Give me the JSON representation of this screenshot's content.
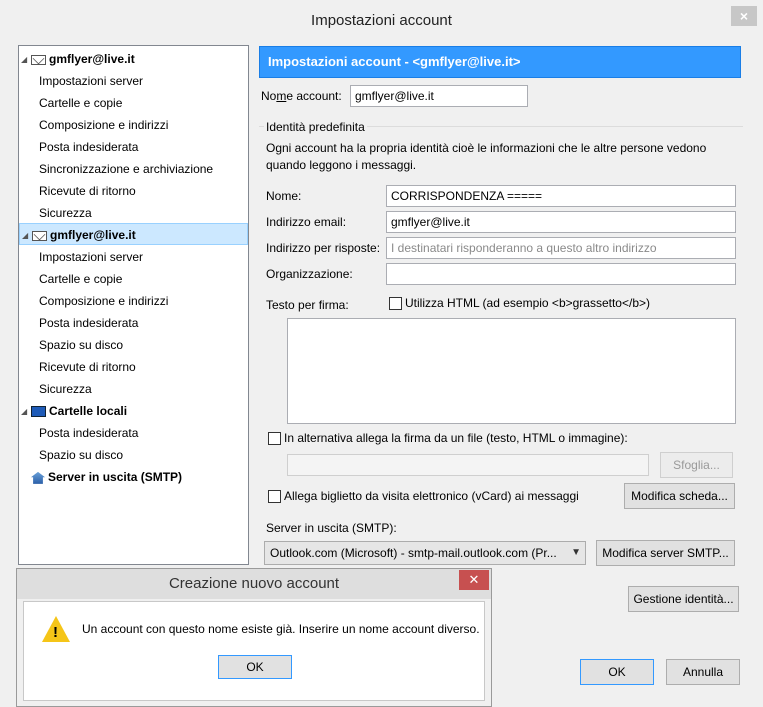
{
  "window": {
    "title": "Impostazioni account",
    "close_label": "×"
  },
  "tree": {
    "accounts": [
      {
        "name": "gmflyer@live.it",
        "items": [
          "Impostazioni server",
          "Cartelle e copie",
          "Composizione e indirizzi",
          "Posta indesiderata",
          "Sincronizzazione e archiviazione",
          "Ricevute di ritorno",
          "Sicurezza"
        ]
      },
      {
        "name": "gmflyer@live.it",
        "items": [
          "Impostazioni server",
          "Cartelle e copie",
          "Composizione e indirizzi",
          "Posta indesiderata",
          "Spazio su disco",
          "Ricevute di ritorno",
          "Sicurezza"
        ]
      }
    ],
    "local": {
      "name": "Cartelle locali",
      "items": [
        "Posta indesiderata",
        "Spazio su disco"
      ]
    },
    "smtp": "Server in uscita (SMTP)"
  },
  "panel": {
    "header": "Impostazioni account - <gmflyer@live.it>",
    "account_name_label_pre": "No",
    "account_name_label_u": "m",
    "account_name_label_post": "e account:",
    "account_name_value": "gmflyer@live.it",
    "identity_group": "Identità predefinita",
    "identity_desc_1": "Ogni account ha la propria identità cioè le informazioni che le altre persone vedono",
    "identity_desc_2": "quando leggono i messaggi.",
    "name_label": "Nome:",
    "name_value": "CORRISPONDENZA =====",
    "email_label": "Indirizzo email:",
    "email_value": "gmflyer@live.it",
    "reply_label": "Indirizzo per risposte:",
    "reply_placeholder": "I destinatari risponderanno a questo altro indirizzo",
    "org_label": "Organizzazione:",
    "org_value": "",
    "signature_label": "Testo per firma:",
    "use_html_label": "Utilizza HTML (ad esempio <b>grassetto</b>)",
    "attach_sig_label": "In alternativa allega la firma da un file (testo, HTML o immagine):",
    "browse_button": "Sfoglia...",
    "vcard_label": "Allega biglietto da visita elettronico (vCard) ai messaggi",
    "edit_card_button": "Modifica scheda...",
    "smtp_label": "Server in uscita (SMTP):",
    "smtp_value": "Outlook.com (Microsoft) - smtp-mail.outlook.com (Pr...",
    "edit_smtp_button": "Modifica server SMTP...",
    "manage_identities_button": "Gestione identità...",
    "ok_button": "OK",
    "cancel_button": "Annulla"
  },
  "dialog": {
    "title": "Creazione nuovo account",
    "close_label": "✕",
    "message": "Un account con questo nome esiste già. Inserire un nome account diverso.",
    "ok_button": "OK"
  }
}
